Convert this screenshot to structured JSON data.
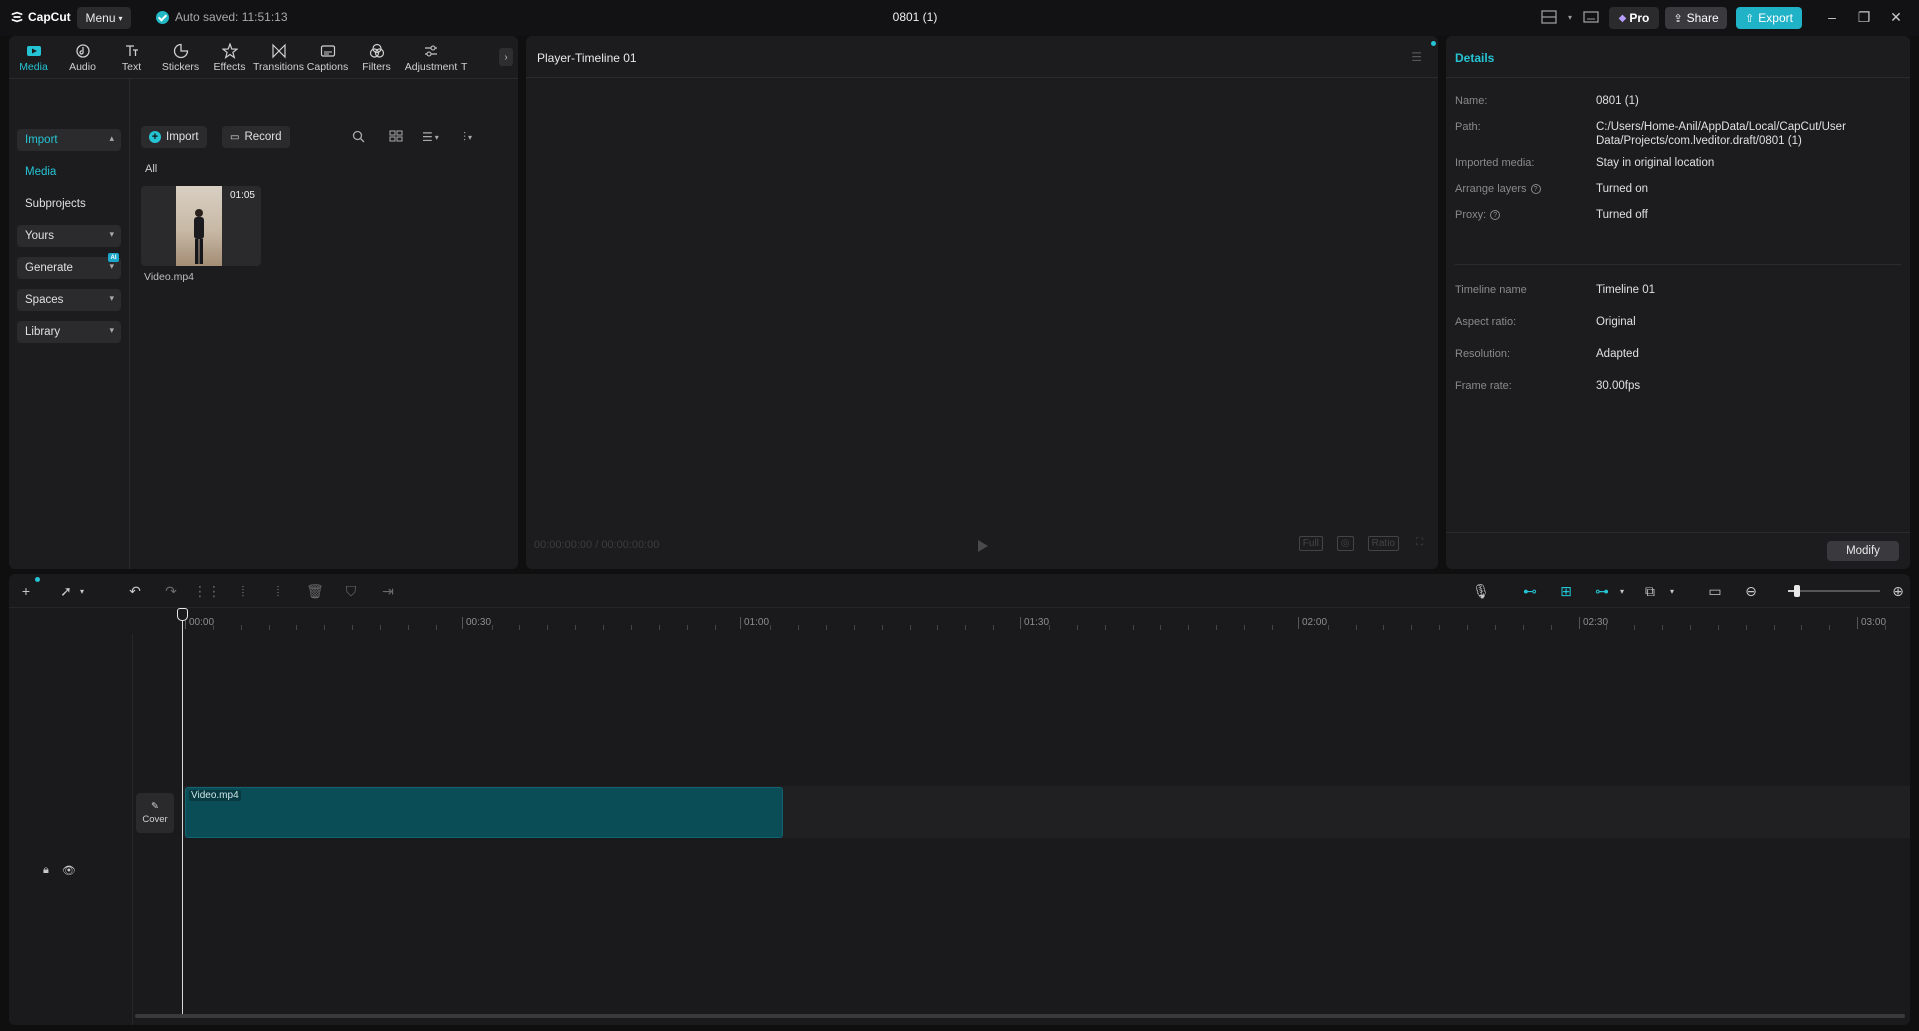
{
  "titlebar": {
    "app_name": "CapCut",
    "menu_label": "Menu",
    "autosave": "Auto saved: 11:51:13",
    "doc_title": "0801 (1)",
    "pro_label": "Pro",
    "share_label": "Share",
    "export_label": "Export"
  },
  "tool_tabs": [
    {
      "label": "Media",
      "icon": "media-icon",
      "active": true
    },
    {
      "label": "Audio",
      "icon": "audio-icon"
    },
    {
      "label": "Text",
      "icon": "text-icon"
    },
    {
      "label": "Stickers",
      "icon": "stickers-icon"
    },
    {
      "label": "Effects",
      "icon": "effects-icon"
    },
    {
      "label": "Transitions",
      "icon": "transitions-icon"
    },
    {
      "label": "Captions",
      "icon": "captions-icon"
    },
    {
      "label": "Filters",
      "icon": "filters-icon"
    },
    {
      "label": "Adjustment",
      "icon": "adjustment-icon"
    },
    {
      "label": "T",
      "icon": "templates-icon"
    }
  ],
  "media_sidebar": {
    "import": "Import",
    "media": "Media",
    "subprojects": "Subprojects",
    "yours": "Yours",
    "generate": "Generate",
    "ai_badge": "AI",
    "spaces": "Spaces",
    "library": "Library"
  },
  "media_main": {
    "import_btn": "Import",
    "record_btn": "Record",
    "all_label": "All",
    "item": {
      "name": "Video.mp4",
      "duration": "01:05"
    }
  },
  "player": {
    "title": "Player-Timeline 01",
    "current_time": "00:00:00:00",
    "total_time": "00:00:00:00",
    "ctrl_full": "Full",
    "ctrl_ratio": "Ratio"
  },
  "details": {
    "title": "Details",
    "rows": [
      {
        "label": "Name:",
        "value": "0801 (1)"
      },
      {
        "label": "Path:",
        "value": "C:/Users/Home-Anil/AppData/Local/CapCut/User Data/Projects/com.lveditor.draft/0801 (1)"
      },
      {
        "label": "Imported media:",
        "value": "Stay in original location"
      },
      {
        "label": "Arrange layers",
        "value": "Turned on"
      },
      {
        "label": "Proxy:",
        "value": "Turned off"
      },
      {
        "label": "Timeline name",
        "value": "Timeline 01"
      },
      {
        "label": "Aspect ratio:",
        "value": "Original"
      },
      {
        "label": "Resolution:",
        "value": "Adapted"
      },
      {
        "label": "Frame rate:",
        "value": "30.00fps"
      }
    ],
    "modify_label": "Modify"
  },
  "timeline": {
    "ruler": [
      "00:00",
      "00:30",
      "01:00",
      "01:30",
      "02:00",
      "02:30",
      "03:00"
    ],
    "cover_label": "Cover",
    "clip_label": "Video.mp4",
    "zoom_level": 0.1
  },
  "colors": {
    "accent": "#25c4d4",
    "clip": "#0a4d57",
    "panel": "#1c1c1e"
  }
}
